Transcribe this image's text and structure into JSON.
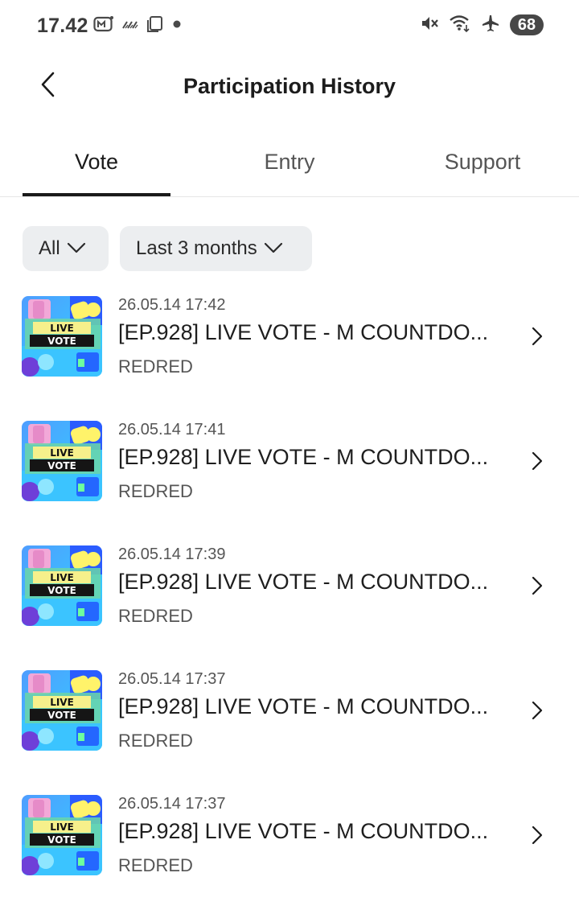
{
  "status_bar": {
    "time": "17.42",
    "battery": "68"
  },
  "header": {
    "title": "Participation History"
  },
  "tabs": [
    {
      "label": "Vote",
      "active": true
    },
    {
      "label": "Entry",
      "active": false
    },
    {
      "label": "Support",
      "active": false
    }
  ],
  "filters": {
    "type": "All",
    "period": "Last 3 months"
  },
  "history": [
    {
      "date": "26.05.14 17:42",
      "title": "[EP.928] LIVE VOTE - M COUNTDO...",
      "subtitle": "REDRED",
      "thumb_text_1": "LIVE",
      "thumb_text_2": "VOTE"
    },
    {
      "date": "26.05.14 17:41",
      "title": "[EP.928] LIVE VOTE - M COUNTDO...",
      "subtitle": "REDRED",
      "thumb_text_1": "LIVE",
      "thumb_text_2": "VOTE"
    },
    {
      "date": "26.05.14 17:39",
      "title": "[EP.928] LIVE VOTE - M COUNTDO...",
      "subtitle": "REDRED",
      "thumb_text_1": "LIVE",
      "thumb_text_2": "VOTE"
    },
    {
      "date": "26.05.14 17:37",
      "title": "[EP.928] LIVE VOTE - M COUNTDO...",
      "subtitle": "REDRED",
      "thumb_text_1": "LIVE",
      "thumb_text_2": "VOTE"
    },
    {
      "date": "26.05.14 17:37",
      "title": "[EP.928] LIVE VOTE - M COUNTDO...",
      "subtitle": "REDRED",
      "thumb_text_1": "LIVE",
      "thumb_text_2": "VOTE"
    }
  ]
}
